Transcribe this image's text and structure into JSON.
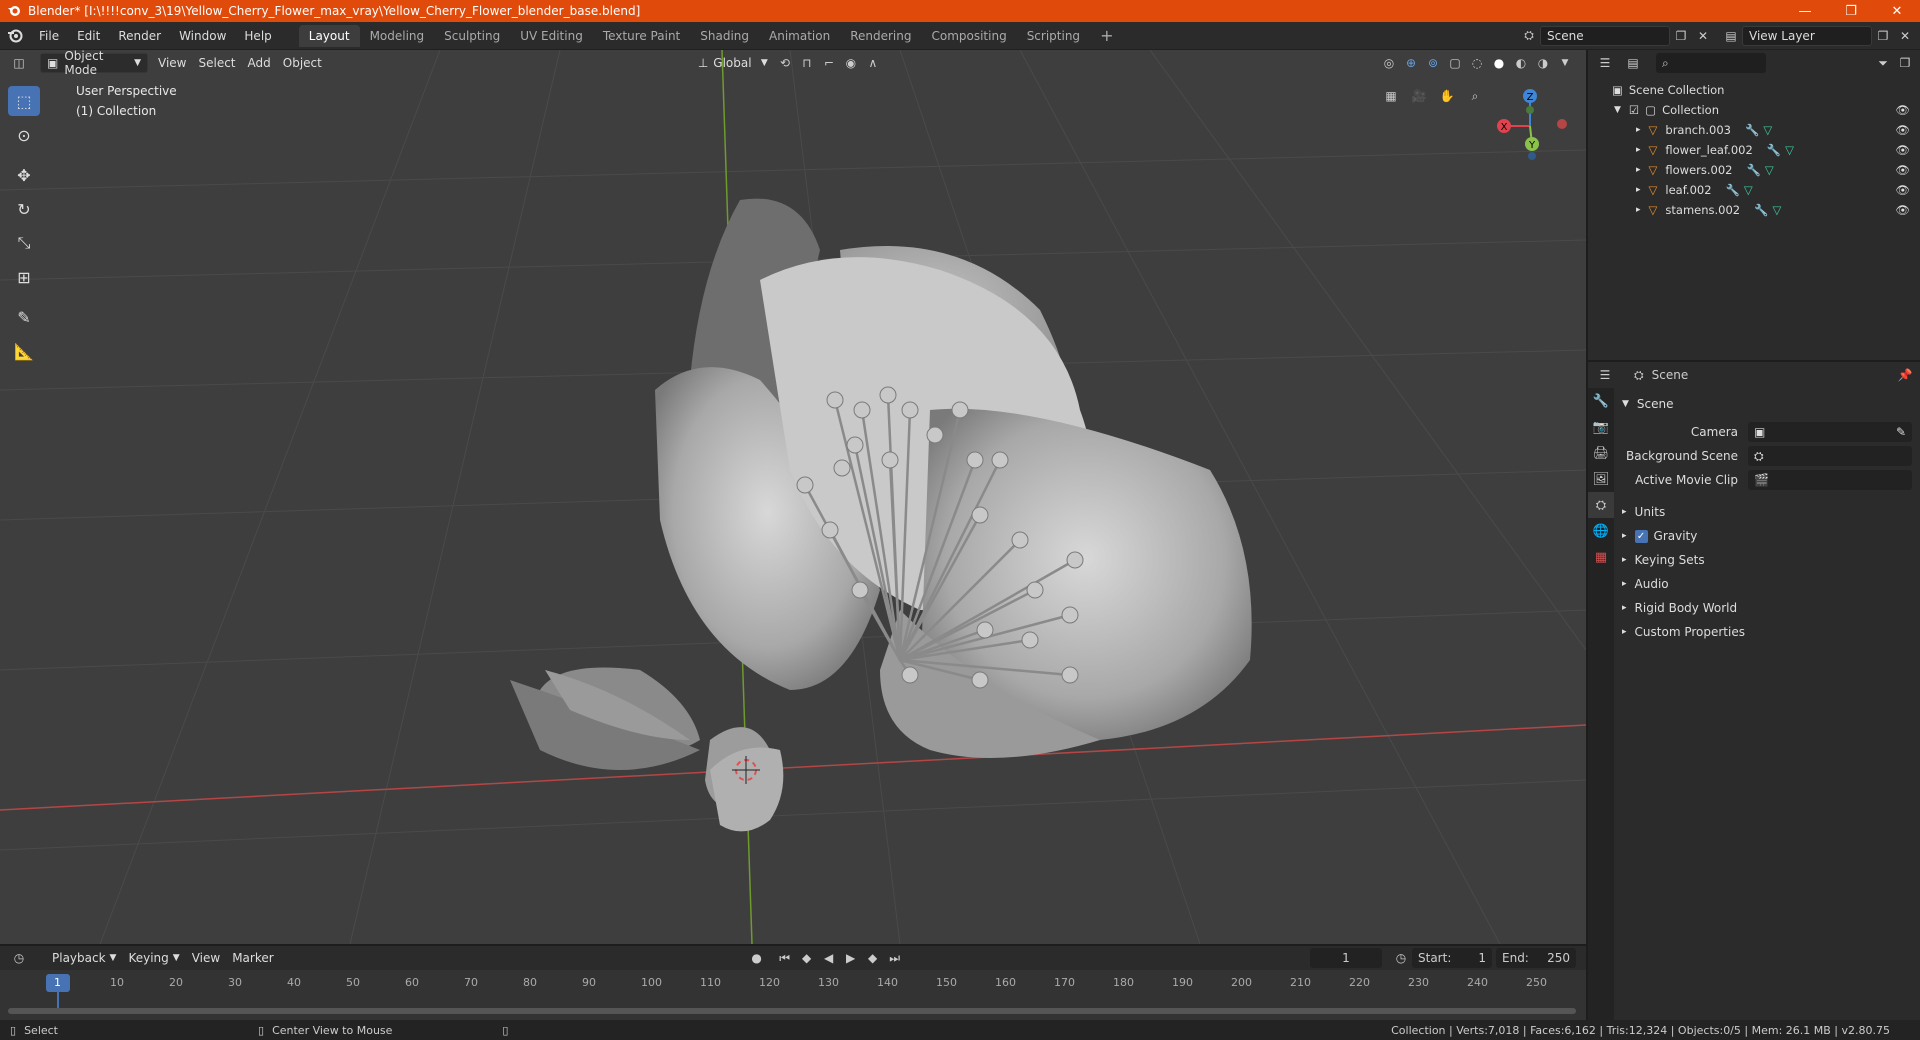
{
  "window": {
    "title": "Blender* [I:\\!!!!conv_3\\19\\Yellow_Cherry_Flower_max_vray\\Yellow_Cherry_Flower_blender_base.blend]",
    "minimize": "—",
    "maximize": "❐",
    "close": "✕"
  },
  "menu": {
    "items": [
      "File",
      "Edit",
      "Render",
      "Window",
      "Help"
    ],
    "workspaces": [
      "Layout",
      "Modeling",
      "Sculpting",
      "UV Editing",
      "Texture Paint",
      "Shading",
      "Animation",
      "Rendering",
      "Compositing",
      "Scripting"
    ],
    "active_workspace": "Layout",
    "add_workspace": "+",
    "scene": "Scene",
    "view_layer": "View Layer"
  },
  "viewport": {
    "mode": "Object Mode",
    "menus": [
      "View",
      "Select",
      "Add",
      "Object"
    ],
    "transform_orientation": "Global",
    "perspective_label": "User Perspective",
    "collection_label": "(1) Collection",
    "gizmo": {
      "x": "X",
      "y": "Y",
      "z": "Z"
    }
  },
  "outliner": {
    "search_placeholder": "",
    "root": "Scene Collection",
    "collection": "Collection",
    "objects": [
      "branch.003",
      "flower_leaf.002",
      "flowers.002",
      "leaf.002",
      "stamens.002"
    ]
  },
  "properties": {
    "context": "Scene",
    "panel_title": "Scene",
    "camera_label": "Camera",
    "background_scene_label": "Background Scene",
    "active_movie_clip_label": "Active Movie Clip",
    "sections": [
      "Units",
      "Gravity",
      "Keying Sets",
      "Audio",
      "Rigid Body World",
      "Custom Properties"
    ],
    "gravity_checked": true
  },
  "timeline": {
    "menus": [
      "Playback",
      "Keying",
      "View",
      "Marker"
    ],
    "current_frame": "1",
    "start_label": "Start:",
    "start": "1",
    "end_label": "End:",
    "end": "250",
    "ticks": [
      "1",
      "10",
      "20",
      "30",
      "40",
      "50",
      "60",
      "70",
      "80",
      "90",
      "100",
      "110",
      "120",
      "130",
      "140",
      "150",
      "160",
      "170",
      "180",
      "190",
      "200",
      "210",
      "220",
      "230",
      "240",
      "250"
    ]
  },
  "status": {
    "select": "Select",
    "center_view": "Center View to Mouse",
    "stats": "Collection | Verts:7,018 | Faces:6,162 | Tris:12,324 | Objects:0/5 | Mem: 26.1 MB | v2.80.75"
  },
  "colors": {
    "titlebar": "#e04a0a",
    "active_blue": "#4772b3",
    "x_axis": "#e0434e",
    "y_axis": "#8bc34a",
    "z_axis": "#3f86d8",
    "object_orange": "#e8902e"
  }
}
